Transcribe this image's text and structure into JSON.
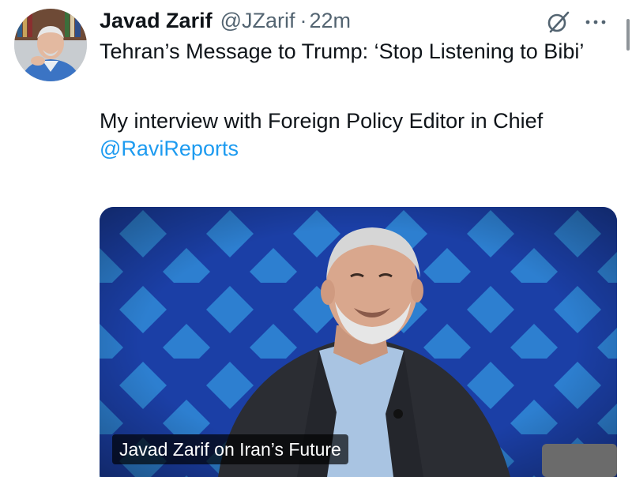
{
  "tweet": {
    "author_name": "Javad Zarif",
    "handle": "@JZarif",
    "separator": "·",
    "time": "22m",
    "text_line1": "Tehran’s Message to Trump: ‘Stop Listening to Bibi’",
    "text_line2": "My interview with Foreign Policy Editor in Chief",
    "mention": "@RaviReports",
    "media_caption": "Javad Zarif on Iran’s Future"
  },
  "icons": {
    "grok": "grok-icon",
    "more": "more-icon"
  },
  "colors": {
    "text": "#0f1419",
    "secondary": "#536471",
    "link": "#1d9bf0",
    "media_background": "#1b3fa6"
  }
}
